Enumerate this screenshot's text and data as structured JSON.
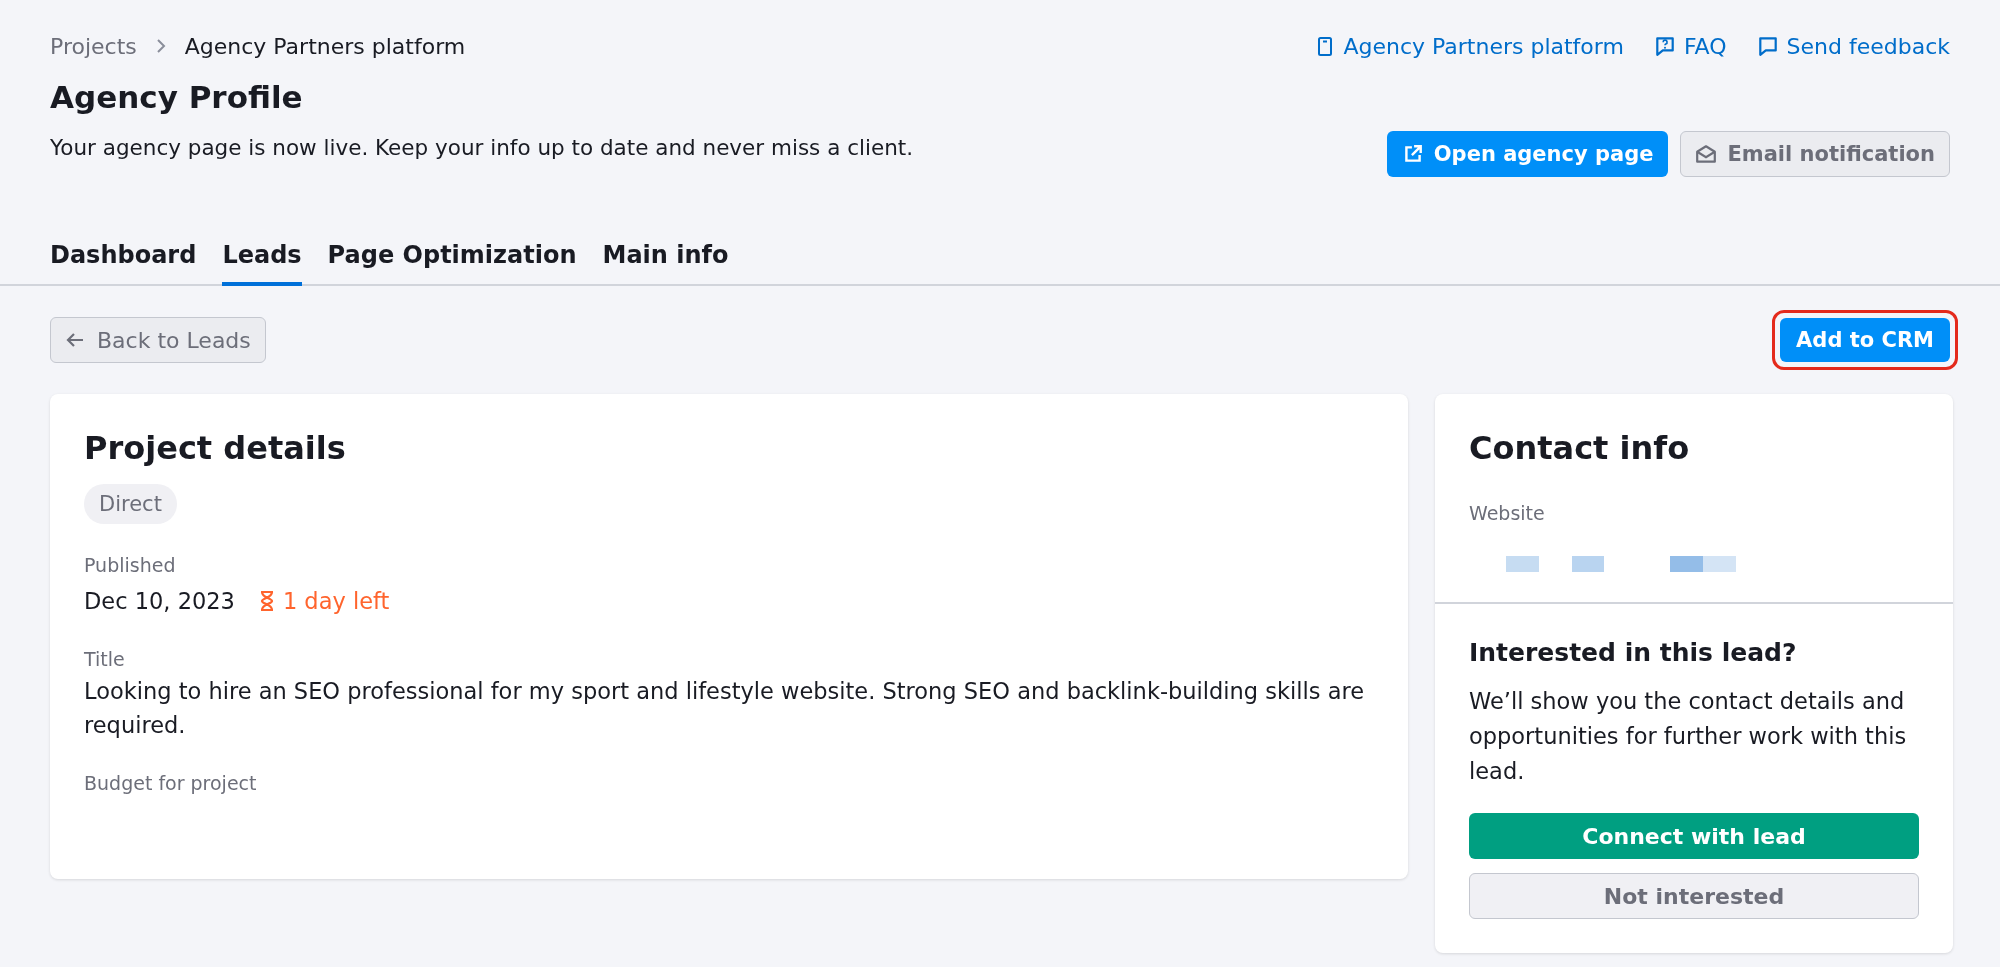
{
  "breadcrumb": [
    {
      "label": "Projects",
      "current": false
    },
    {
      "label": "Agency Partners platform",
      "current": true
    }
  ],
  "header_links": [
    {
      "kind": "book",
      "label": "Agency Partners platform"
    },
    {
      "kind": "faq",
      "label": "FAQ"
    },
    {
      "kind": "chat",
      "label": "Send feedback"
    }
  ],
  "title": "Agency Profile",
  "subtitle": "Your agency page is now live. Keep your info up to date and never miss a client.",
  "header_buttons": [
    {
      "kind": "primary",
      "label": "Open agency page"
    },
    {
      "kind": "secondary",
      "label": "Email notification"
    }
  ],
  "tabs": [
    {
      "label": "Dashboard",
      "selected": false
    },
    {
      "label": "Leads",
      "selected": true
    },
    {
      "label": "Page Optimization",
      "selected": false
    },
    {
      "label": "Main info",
      "selected": false
    }
  ],
  "back_button": "Back to Leads",
  "add_button": {
    "label": "Add to CRM",
    "highlighted": true
  },
  "project": {
    "title": "Project details",
    "tag": "Direct",
    "published_label": "Published",
    "published": "Dec 10, 2023",
    "time_left": "1 day left",
    "title_label": "Title",
    "title_value": "Looking to hire an SEO professional for my sport and lifestyle website. Strong SEO and backlink-building skills are required.",
    "budget_label": "Budget for project"
  },
  "contact": {
    "title": "Contact info",
    "website_label": "Website",
    "website_blurred": true,
    "question": "Interested in this lead?",
    "text": "We’ll show you the contact details and opportunities for further work with this lead.",
    "connect": "Connect with lead",
    "decline": "Not interested"
  }
}
